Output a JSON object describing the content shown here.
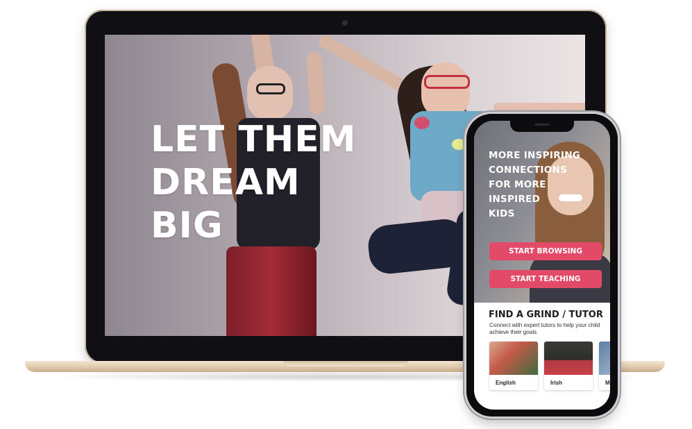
{
  "laptop": {
    "hero_title": "LET THEM\nDREAM\nBIG"
  },
  "phone": {
    "hero_text": "MORE INSPIRING\nCONNECTIONS\nFOR MORE\nINSPIRED\nKIDS",
    "buttons": {
      "start_browsing": "START BROWSING",
      "start_teaching": "START TEACHING"
    },
    "find_section": {
      "title": "FIND A GRIND  /  TUTOR",
      "subtitle": "Connect with expert tutors to help your child achieve their goals"
    },
    "subject_cards": [
      {
        "label": "English"
      },
      {
        "label": "Irish"
      },
      {
        "label": "Ma"
      }
    ]
  },
  "colors": {
    "accent": "#e24a67",
    "laptop_gold": "#e4cfb4",
    "device_black": "#0c0c0e"
  }
}
